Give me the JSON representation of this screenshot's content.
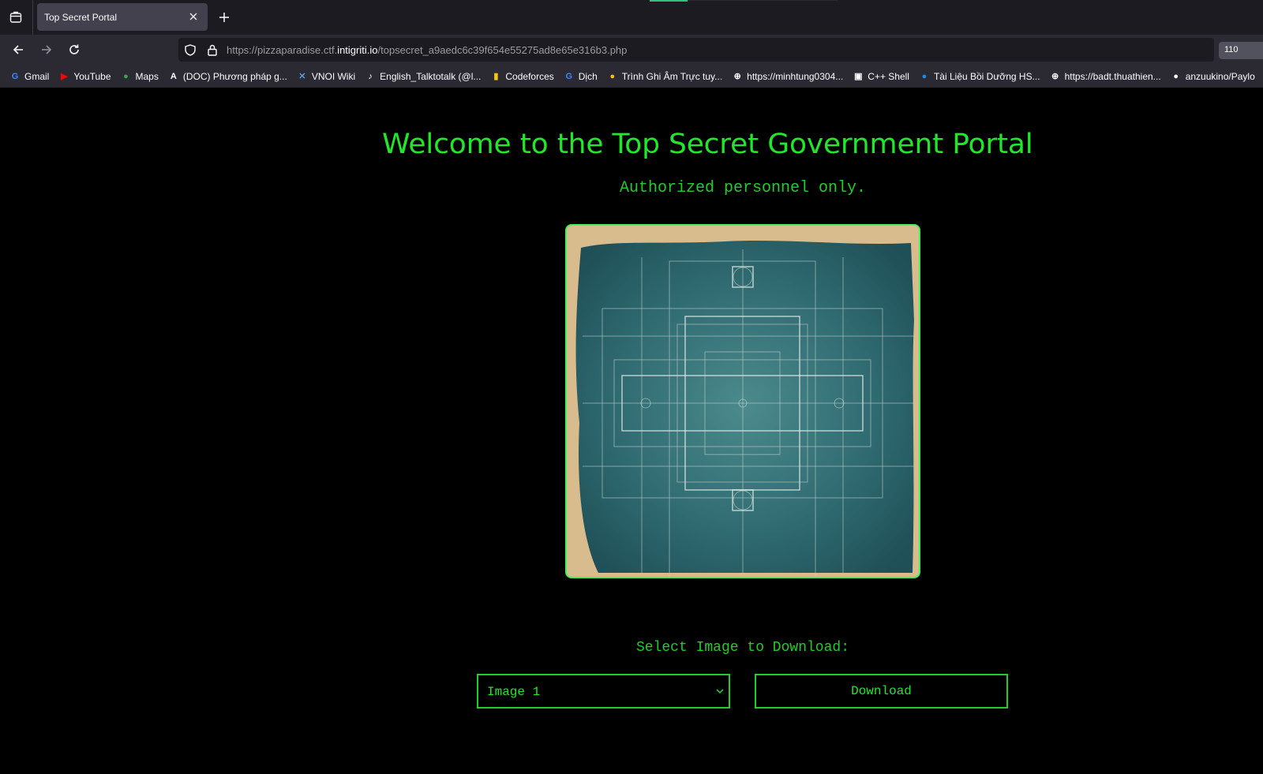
{
  "browser": {
    "tab": {
      "title": "Top Secret Portal"
    },
    "url": {
      "prefix": "https://pizzaparadise.ctf.",
      "domain": "intigriti.io",
      "path": "/topsecret_a9aedc6c39f654e55275ad8e65e316b3.php"
    },
    "zoom": "110",
    "bookmarks": [
      {
        "label": "Gmail",
        "icon": "google-icon",
        "color": "#4285f4",
        "glyph": "G"
      },
      {
        "label": "YouTube",
        "icon": "youtube-icon",
        "color": "#ff0000",
        "glyph": "▶"
      },
      {
        "label": "Maps",
        "icon": "maps-pin-icon",
        "color": "#34a853",
        "glyph": "●"
      },
      {
        "label": "(DOC) Phương pháp g...",
        "icon": "academia-icon",
        "color": "#ffffff",
        "glyph": "A"
      },
      {
        "label": "VNOI Wiki",
        "icon": "vnoi-icon",
        "color": "#5b9bd5",
        "glyph": "✕"
      },
      {
        "label": "English_Talktotalk (@l...",
        "icon": "tiktok-icon",
        "color": "#ffffff",
        "glyph": "♪"
      },
      {
        "label": "Codeforces",
        "icon": "codeforces-icon",
        "color": "#f5c518",
        "glyph": "▮"
      },
      {
        "label": "Dịch",
        "icon": "translate-icon",
        "color": "#4285f4",
        "glyph": "G"
      },
      {
        "label": "Trình Ghi Âm Trực tuy...",
        "icon": "recorder-icon",
        "color": "#fbbc05",
        "glyph": "●"
      },
      {
        "label": "https://minhtung0304...",
        "icon": "globe-icon",
        "color": "#fbfbfe",
        "glyph": "⊕"
      },
      {
        "label": "C++ Shell",
        "icon": "cpp-shell-icon",
        "color": "#ffffff",
        "glyph": "▣"
      },
      {
        "label": "Tài Liệu Bồi Dưỡng HS...",
        "icon": "blue-globe-icon",
        "color": "#1e88e5",
        "glyph": "●"
      },
      {
        "label": "https://badt.thuathien...",
        "icon": "globe-icon",
        "color": "#fbfbfe",
        "glyph": "⊕"
      },
      {
        "label": "anzuukino/Paylo",
        "icon": "github-icon",
        "color": "#ffffff",
        "glyph": "●"
      }
    ]
  },
  "page": {
    "title": "Welcome to the Top Secret Government Portal",
    "subtitle": "Authorized personnel only.",
    "image_alt": "blueprint image",
    "select_label": "Select Image to Download:",
    "select_value": "Image 1",
    "download_label": "Download"
  },
  "colors": {
    "accent": "#22e62b",
    "background": "#000000"
  }
}
